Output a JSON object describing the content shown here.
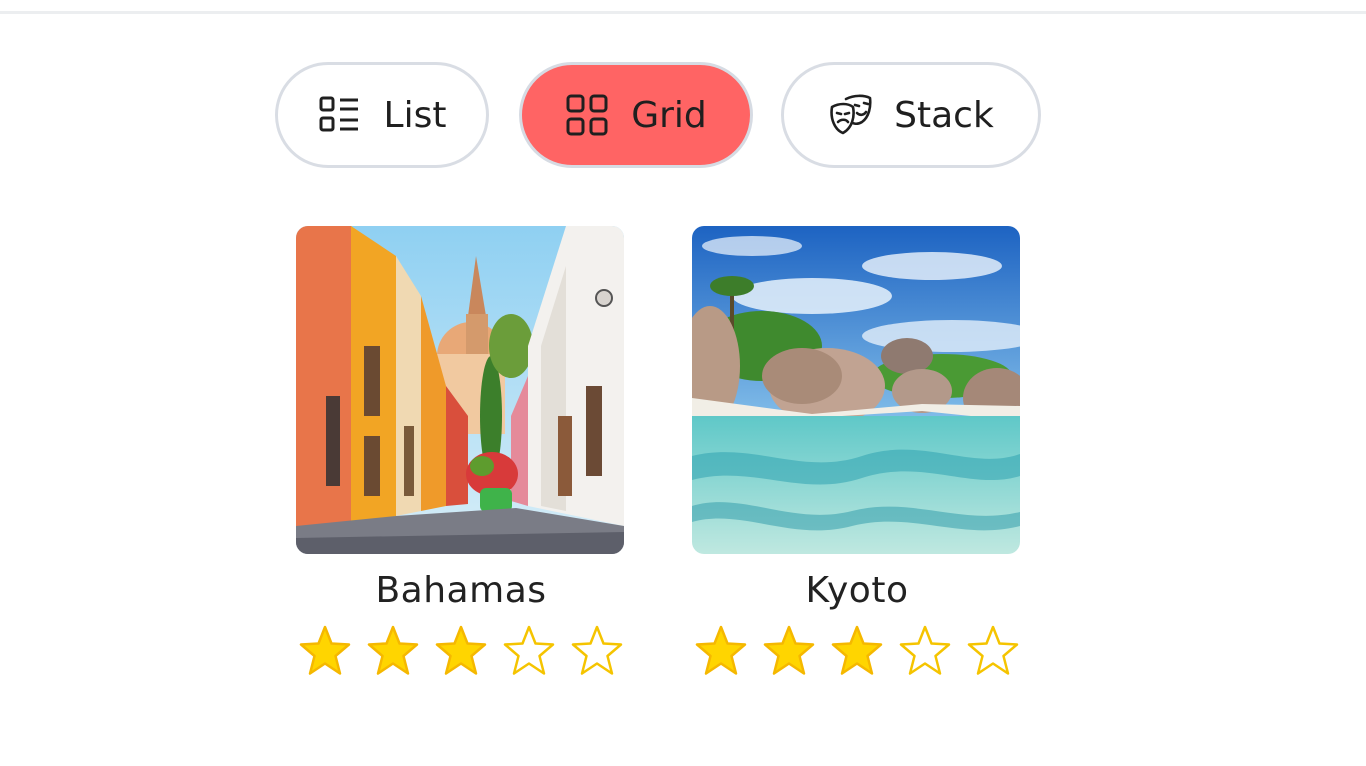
{
  "view_toggle": {
    "list_label": "List",
    "grid_label": "Grid",
    "stack_label": "Stack",
    "active": "Grid",
    "active_color": "#ff6464",
    "list_icon": "list-icon",
    "grid_icon": "grid-icon",
    "stack_icon": "theater-masks-icon"
  },
  "destinations": [
    {
      "name": "Bahamas",
      "rating": 3,
      "max_rating": 5,
      "image": "colorful-street-photo"
    },
    {
      "name": "Kyoto",
      "rating": 3,
      "max_rating": 5,
      "image": "tropical-beach-photo"
    }
  ],
  "star_color": "#ffd500"
}
